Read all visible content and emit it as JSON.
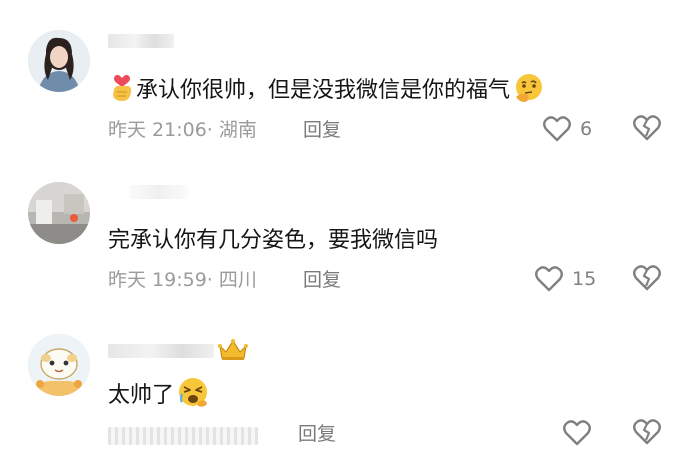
{
  "comments": [
    {
      "text": "承认你很帅，但是没我微信是你的福气",
      "time": "昨天 21:06",
      "location": "湖南",
      "reply_label": "回复",
      "likes": "6",
      "avatar": "woman-photo",
      "prefix_emoji": "heart-hand-icon",
      "suffix_emoji": "thinking-face-icon"
    },
    {
      "text": "完承认你有几分姿色，要我微信吗",
      "time": "昨天 19:59",
      "location": "四川",
      "reply_label": "回复",
      "likes": "15",
      "avatar": "room-photo"
    },
    {
      "text": "太帅了",
      "time": "",
      "location": "",
      "reply_label": "回复",
      "likes": "",
      "avatar": "cartoon-sheep",
      "badge": "crown-icon",
      "suffix_emoji": "crying-face-icon"
    }
  ],
  "colors": {
    "meta": "#9b9b9b",
    "text": "#161616",
    "icon": "#808080"
  }
}
